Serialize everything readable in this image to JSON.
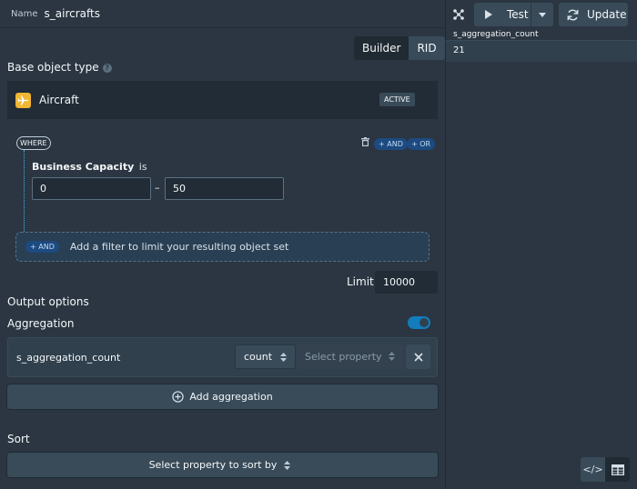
{
  "header": {
    "name_label": "Name",
    "name_value": "s_aircrafts"
  },
  "mode_toggle": {
    "options": [
      "Builder",
      "RID"
    ],
    "selected": "RID"
  },
  "base_object": {
    "label": "Base object type",
    "help_icon": "?",
    "object_name": "Aircraft",
    "status": "ACTIVE",
    "icon": "airplane-icon",
    "icon_color": "#f2b632"
  },
  "filter": {
    "where_label": "WHERE",
    "and_label": "+ AND",
    "or_label": "+ OR",
    "property": "Business Capacity",
    "operator": "is",
    "range_min": "0",
    "range_separator": "–",
    "range_max": "50",
    "add_filter_and": "+ AND",
    "add_filter_text": "Add a filter to limit your resulting object set"
  },
  "limit": {
    "label": "Limit",
    "value": "10000"
  },
  "output": {
    "title": "Output options",
    "aggregation_label": "Aggregation",
    "aggregation_enabled": true,
    "aggregations": [
      {
        "name": "s_aggregation_count",
        "function": "count",
        "property_placeholder": "Select property"
      }
    ],
    "add_aggregation_label": "Add aggregation"
  },
  "sort": {
    "label": "Sort",
    "button_label": "Select property to sort by"
  },
  "toolbar": {
    "test_label": "Test",
    "update_label": "Update"
  },
  "results": {
    "column": "s_aggregation_count",
    "rows": [
      "21"
    ]
  },
  "view_switch": {
    "code_glyph": "</>",
    "selected": "table"
  },
  "colors": {
    "accent": "#137cbd",
    "pill": "#1d4a80",
    "background": "#2b3642"
  }
}
